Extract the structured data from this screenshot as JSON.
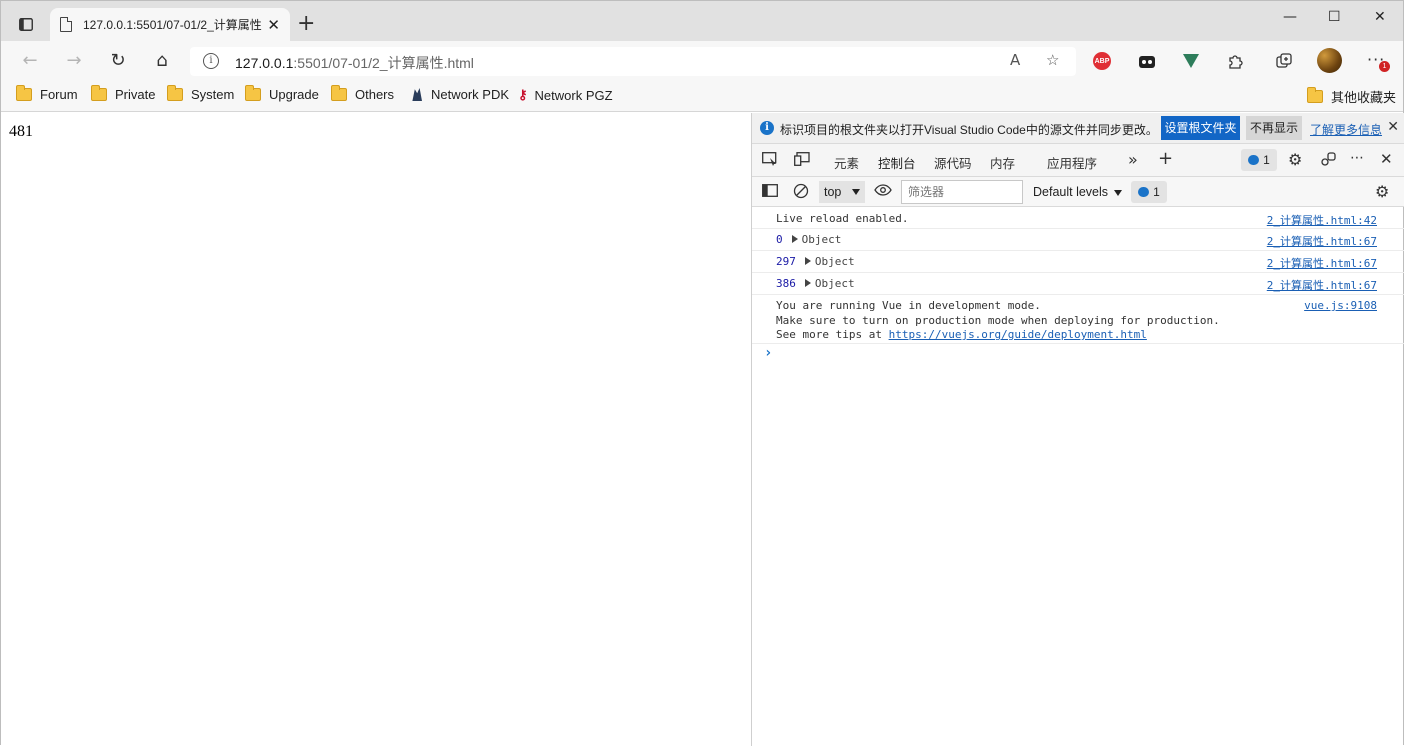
{
  "tab": {
    "title": "127.0.0.1:5501/07-01/2_计算属性",
    "close": "✕",
    "new_tab": "+"
  },
  "window_controls": {
    "minimize": "—",
    "maximize": "☐",
    "close": "✕"
  },
  "nav": {
    "back": "←",
    "forward": "→",
    "reload": "↻",
    "home": "⌂"
  },
  "address": {
    "host": "127.0.0.1",
    "path": ":5501/07-01/2_计算属性.html",
    "read_aloud": "A",
    "favorite": "☆"
  },
  "extensions": {
    "abp": "ABP",
    "badge_count": "1"
  },
  "bookmarks": {
    "items": [
      {
        "label": "Forum"
      },
      {
        "label": "Private"
      },
      {
        "label": "System"
      },
      {
        "label": "Upgrade"
      },
      {
        "label": "Others"
      },
      {
        "label": "Network PDK"
      },
      {
        "label": "Network PGZ"
      }
    ],
    "other": "其他收藏夹"
  },
  "page": {
    "output": "481"
  },
  "devtools": {
    "infobar": {
      "message": "标识项目的根文件夹以打开Visual Studio Code中的源文件并同步更改。",
      "primary": "设置根文件夹",
      "secondary": "不再显示",
      "link": "了解更多信息",
      "close": "✕"
    },
    "tabs": [
      "元素",
      "控制台",
      "源代码",
      "内存",
      "应用程序"
    ],
    "active_tab": "控制台",
    "issues_count": "1",
    "console_bar": {
      "context": "top",
      "filter_placeholder": "筛选器",
      "levels": "Default levels",
      "issues_count": "1"
    },
    "logs": [
      {
        "message": "Live reload enabled.",
        "source": "2_计算属性.html:42"
      },
      {
        "num": "0",
        "message": "Object",
        "source": "2_计算属性.html:67"
      },
      {
        "num": "297",
        "message": "Object",
        "source": "2_计算属性.html:67"
      },
      {
        "num": "386",
        "message": "Object",
        "source": "2_计算属性.html:67"
      }
    ],
    "vue_warning": {
      "line1": "You are running Vue in development mode.",
      "line2": "Make sure to turn on production mode when deploying for production.",
      "line3_prefix": "See more tips at ",
      "line3_link": "https://vuejs.org/guide/deployment.html",
      "source": "vue.js:9108"
    },
    "prompt": "›"
  }
}
